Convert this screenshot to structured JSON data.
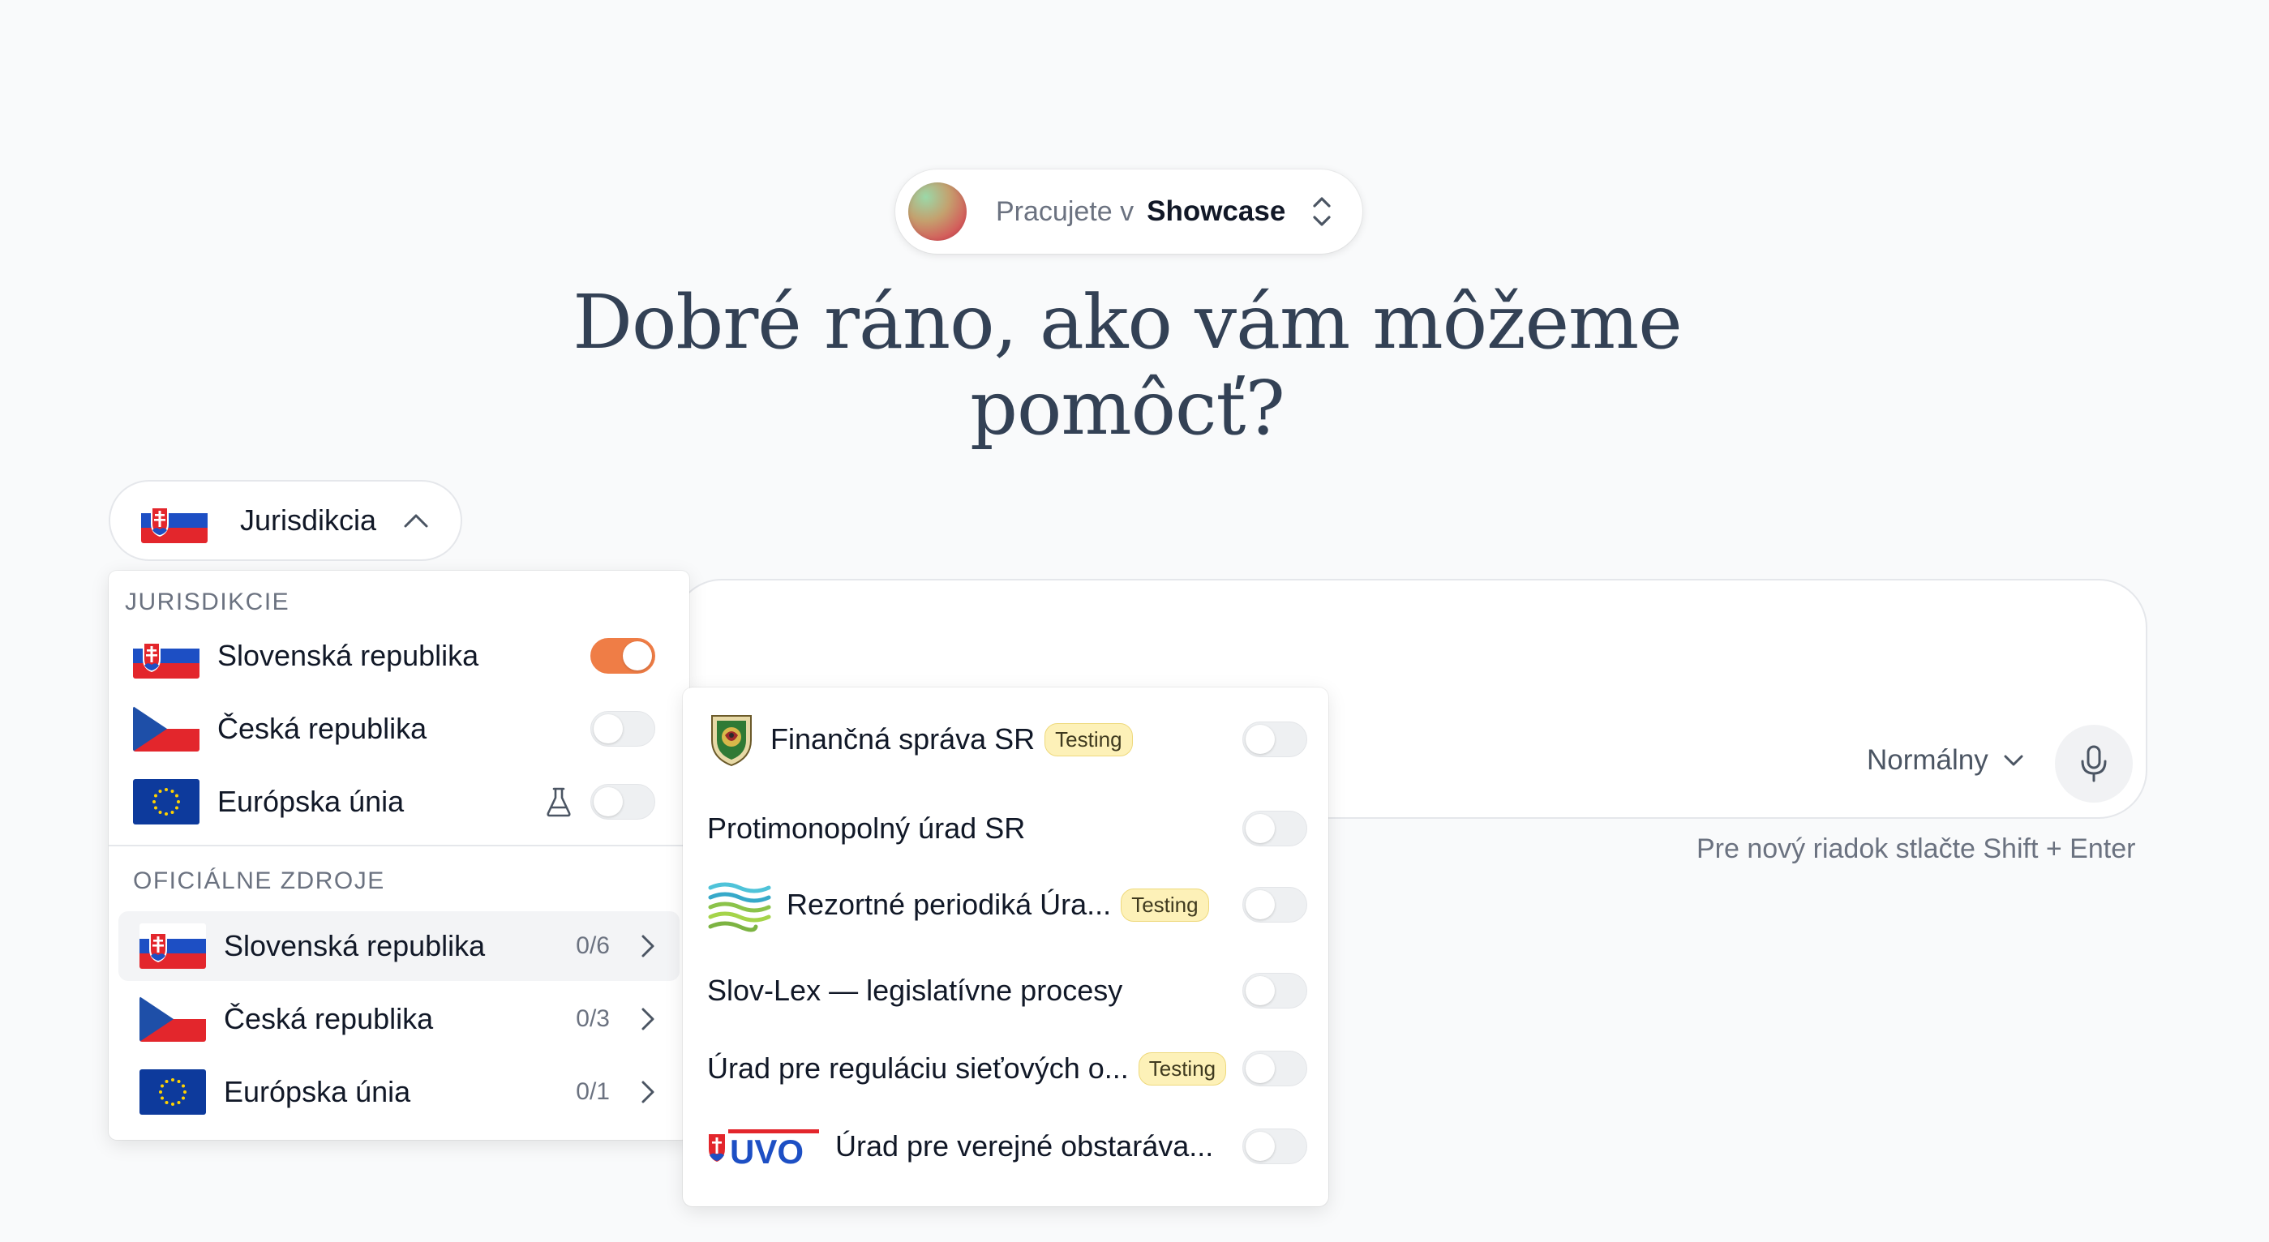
{
  "workspace": {
    "prefix": "Pracujete v",
    "name": "Showcase"
  },
  "heading": "Dobré ráno, ako vám môžeme pomôcť?",
  "jurisdiction_button": {
    "label": "Jurisdikcia",
    "flag": "slovakia-flag"
  },
  "composer": {
    "mode_label": "Normálny",
    "mic_icon": "microphone-icon",
    "hint": "Pre nový riadok stlačte Shift + Enter"
  },
  "jurisdiction_menu": {
    "section_jurisdictions": "JURISDIKCIE",
    "jurisdictions": [
      {
        "label": "Slovenská republika",
        "flag": "slovakia-flag",
        "enabled": true
      },
      {
        "label": "Česká republika",
        "flag": "czech-flag",
        "enabled": false
      },
      {
        "label": "Európska únia",
        "flag": "eu-flag",
        "enabled": false,
        "icon": "beaker-icon"
      }
    ],
    "section_sources": "OFICIÁLNE ZDROJE",
    "sources": [
      {
        "label": "Slovenská republika",
        "flag": "slovakia-flag",
        "count": "0/6"
      },
      {
        "label": "Česká republika",
        "flag": "czech-flag",
        "count": "0/3"
      },
      {
        "label": "Európska únia",
        "flag": "eu-flag",
        "count": "0/1"
      }
    ]
  },
  "sources_submenu": {
    "items": [
      {
        "label": "Finančná správa SR",
        "badge": "Testing",
        "logo": "financna-sprava-crest-icon",
        "enabled": false
      },
      {
        "label": "Protimonopolný úrad SR",
        "enabled": false
      },
      {
        "label": "Rezortné periodiká Úra...",
        "badge": "Testing",
        "logo": "wave-stripes-logo-icon",
        "enabled": false
      },
      {
        "label": "Slov-Lex — legislatívne procesy",
        "enabled": false
      },
      {
        "label": "Úrad pre reguláciu sieťových o...",
        "badge": "Testing",
        "enabled": false
      },
      {
        "label": "Úrad pre verejné obstaráva...",
        "logo": "uvo-logo-icon",
        "enabled": false
      }
    ]
  },
  "colors": {
    "toggle_on": "#ef7d46",
    "badge_bg": "#fdf1b8",
    "heading": "#334155"
  }
}
